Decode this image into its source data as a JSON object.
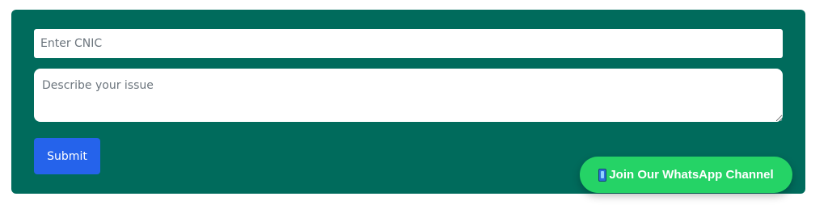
{
  "form": {
    "cnic_placeholder": "Enter CNIC",
    "cnic_value": "",
    "issue_placeholder": "Describe your issue",
    "issue_value": "",
    "submit_label": "Submit"
  },
  "whatsapp": {
    "icon": "mobile-phone-icon",
    "label": "Join Our WhatsApp Channel"
  },
  "colors": {
    "panel_bg": "#006b5c",
    "submit_bg": "#2563eb",
    "whatsapp_bg": "#25d366"
  }
}
